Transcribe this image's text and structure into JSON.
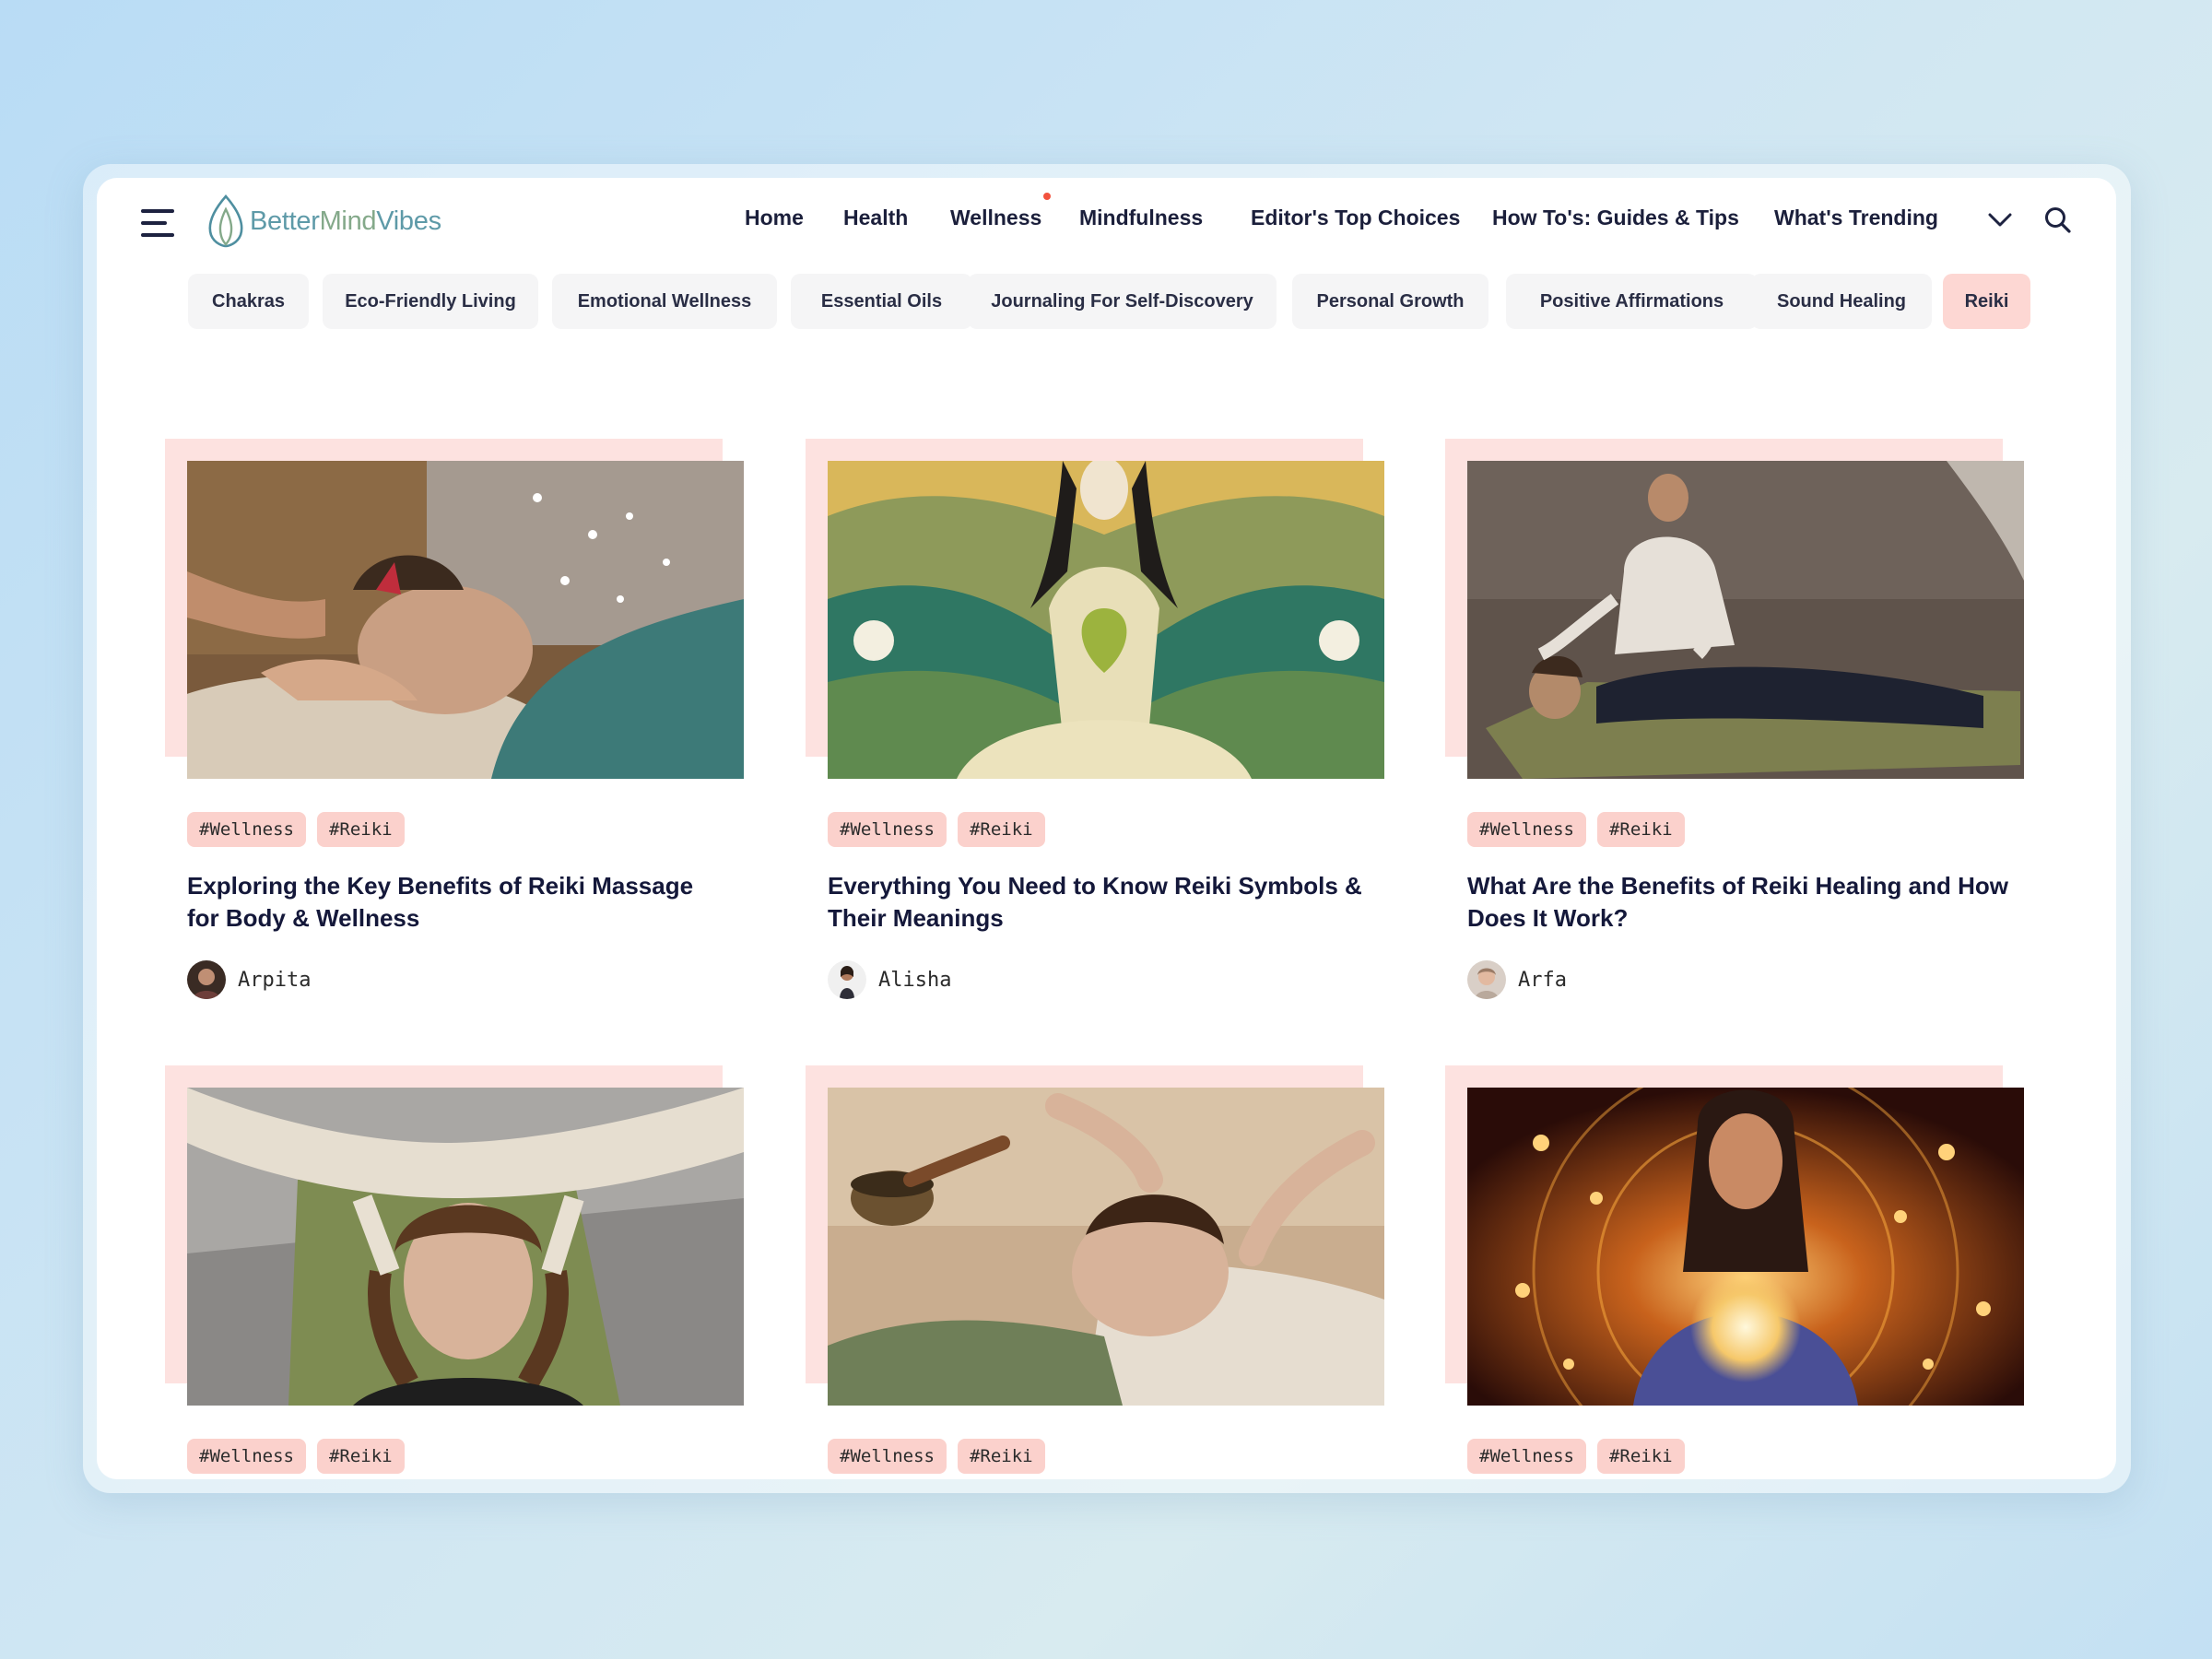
{
  "brand": {
    "name_part1": "Better",
    "name_part2": "Mind",
    "name_part3": "Vibes"
  },
  "nav": {
    "items": [
      "Home",
      "Health",
      "Wellness",
      "Mindfulness",
      "Editor's Top Choices",
      "How To's: Guides & Tips",
      "What's Trending"
    ],
    "more_icon": "chevron-down-icon",
    "search_icon": "search-icon",
    "notification_dot_color": "#f2523e"
  },
  "categories": {
    "items": [
      "Chakras",
      "Eco-Friendly Living",
      "Emotional Wellness",
      "Essential Oils",
      "Journaling For Self-Discovery",
      "Personal Growth",
      "Positive Affirmations",
      "Sound Healing",
      "Reiki"
    ],
    "active": "Reiki"
  },
  "posts": [
    {
      "tags": [
        "#Wellness",
        "#Reiki"
      ],
      "title": "Exploring the Key Benefits of Reiki Massage for Body & Wellness",
      "author": "Arpita"
    },
    {
      "tags": [
        "#Wellness",
        "#Reiki"
      ],
      "title": "Everything You Need to Know Reiki Symbols & Their Meanings",
      "author": "Alisha"
    },
    {
      "tags": [
        "#Wellness",
        "#Reiki"
      ],
      "title": "What Are the Benefits of Reiki Healing and How Does It Work?",
      "author": "Arfa"
    },
    {
      "tags": [
        "#Wellness",
        "#Reiki"
      ],
      "title": "",
      "author": ""
    },
    {
      "tags": [
        "#Wellness",
        "#Reiki"
      ],
      "title": "",
      "author": ""
    },
    {
      "tags": [
        "#Wellness",
        "#Reiki"
      ],
      "title": "",
      "author": ""
    }
  ],
  "colors": {
    "accent_pink": "#fbd1cc",
    "card_backdrop": "#fde2e0",
    "text_dark": "#14183a"
  }
}
